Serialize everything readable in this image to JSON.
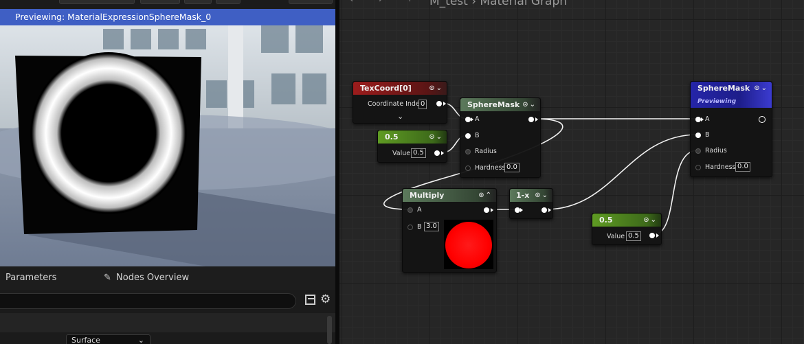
{
  "preview_panel": {
    "title": "Previewing: MaterialExpressionSphereMask_0"
  },
  "bottom_tabs": {
    "parameters": "Parameters",
    "nodes_overview": "Nodes Overview"
  },
  "details": {
    "search_value": "",
    "surface_value": "Surface"
  },
  "graph": {
    "breadcrumb": "M_test  ›  Material Graph",
    "nodes": {
      "texcoord": {
        "title": "TexCoord[0]",
        "coord_label": "Coordinate Index",
        "coord_value": "0"
      },
      "spheremask1": {
        "title": "SphereMask",
        "pin_a": "A",
        "pin_b": "B",
        "pin_radius": "Radius",
        "pin_hardness": "Hardness",
        "hardness_value": "0.0"
      },
      "const1": {
        "title": "0.5",
        "value_label": "Value",
        "value": "0.5"
      },
      "multiply": {
        "title": "Multiply",
        "pin_a": "A",
        "pin_b": "B",
        "b_value": "3.0"
      },
      "oneminus": {
        "title": "1-x"
      },
      "const2": {
        "title": "0.5",
        "value_label": "Value",
        "value": "0.5"
      },
      "spheremask2": {
        "title": "SphereMask",
        "subtitle": "Previewing",
        "pin_a": "A",
        "pin_b": "B",
        "pin_radius": "Radius",
        "pin_hardness": "Hardness",
        "hardness_value": "0.0"
      }
    }
  },
  "colors": {
    "preview_bar": "#3f5fc4",
    "texcoord_header": "#9c1c1c",
    "math_header": "#5c7a5c",
    "constant_header": "#5f9b23",
    "result_header": "#2525a8",
    "swatch": "#ff0000"
  },
  "icons": [
    "parameters-icon",
    "nodes-overview-icon",
    "grid-view-icon",
    "settings-gear-icon",
    "chevron-down-icon",
    "pin-icon"
  ]
}
